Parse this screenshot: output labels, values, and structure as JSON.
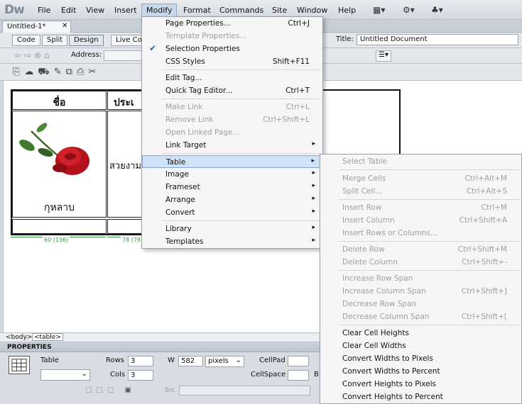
{
  "app": {
    "logo": "Dw"
  },
  "menubar": {
    "items": [
      "File",
      "Edit",
      "View",
      "Insert",
      "Modify",
      "Format",
      "Commands",
      "Site",
      "Window",
      "Help"
    ],
    "active": "Modify"
  },
  "document": {
    "tab_name": "Untitled-1*",
    "close": "✕",
    "views": [
      "Code",
      "Split",
      "Design",
      "Live Co"
    ],
    "title_label": "Title:",
    "title_value": "Untitled Document",
    "address_label": "Address:"
  },
  "canvas": {
    "table_headers": [
      "ชื่อ",
      "ประเ"
    ],
    "flower_name": "กุหลาบ",
    "description": "สวยงาม",
    "width_guides": [
      "60 (136)",
      "78 (79"
    ]
  },
  "tag_selector": [
    "<body>",
    "<table>"
  ],
  "properties": {
    "title": "PROPERTIES",
    "type_label": "Table",
    "rows_label": "Rows",
    "rows_value": "3",
    "cols_label": "Cols",
    "cols_value": "3",
    "w_label": "W",
    "w_value": "582",
    "w_unit": "pixels",
    "cellpad_label": "CellPad",
    "cellspace_label": "CellSpace",
    "border_label": "B",
    "src_label": "Src"
  },
  "modify_menu": [
    {
      "label": "Page Properties...",
      "shortcut": "Ctrl+J",
      "enabled": true
    },
    {
      "label": "Template Properties...",
      "shortcut": "",
      "enabled": false
    },
    {
      "label": "Selection Properties",
      "shortcut": "",
      "enabled": true,
      "checked": true
    },
    {
      "label": "CSS Styles",
      "shortcut": "Shift+F11",
      "enabled": true
    },
    {
      "label": "Edit Tag...",
      "shortcut": "",
      "enabled": true
    },
    {
      "label": "Quick Tag Editor...",
      "shortcut": "Ctrl+T",
      "enabled": true
    },
    {
      "label": "Make Link",
      "shortcut": "Ctrl+L",
      "enabled": false
    },
    {
      "label": "Remove Link",
      "shortcut": "Ctrl+Shift+L",
      "enabled": false
    },
    {
      "label": "Open Linked Page...",
      "shortcut": "",
      "enabled": false
    },
    {
      "label": "Link Target",
      "shortcut": "",
      "enabled": true,
      "submenu": true
    },
    {
      "label": "Table",
      "shortcut": "",
      "enabled": true,
      "submenu": true,
      "highlighted": true
    },
    {
      "label": "Image",
      "shortcut": "",
      "enabled": true,
      "submenu": true
    },
    {
      "label": "Frameset",
      "shortcut": "",
      "enabled": true,
      "submenu": true
    },
    {
      "label": "Arrange",
      "shortcut": "",
      "enabled": true,
      "submenu": true
    },
    {
      "label": "Convert",
      "shortcut": "",
      "enabled": true,
      "submenu": true
    },
    {
      "label": "Library",
      "shortcut": "",
      "enabled": true,
      "submenu": true
    },
    {
      "label": "Templates",
      "shortcut": "",
      "enabled": true,
      "submenu": true
    }
  ],
  "table_menu": [
    {
      "label": "Select Table",
      "shortcut": "",
      "enabled": false
    },
    {
      "label": "Merge Cells",
      "shortcut": "Ctrl+Alt+M",
      "enabled": false
    },
    {
      "label": "Split Cell...",
      "shortcut": "Ctrl+Alt+S",
      "enabled": false
    },
    {
      "label": "Insert Row",
      "shortcut": "Ctrl+M",
      "enabled": false
    },
    {
      "label": "Insert Column",
      "shortcut": "Ctrl+Shift+A",
      "enabled": false
    },
    {
      "label": "Insert Rows or Columns...",
      "shortcut": "",
      "enabled": false
    },
    {
      "label": "Delete Row",
      "shortcut": "Ctrl+Shift+M",
      "enabled": false
    },
    {
      "label": "Delete Column",
      "shortcut": "Ctrl+Shift+-",
      "enabled": false
    },
    {
      "label": "Increase Row Span",
      "shortcut": "",
      "enabled": false
    },
    {
      "label": "Increase Column Span",
      "shortcut": "Ctrl+Shift+]",
      "enabled": false
    },
    {
      "label": "Decrease Row Span",
      "shortcut": "",
      "enabled": false
    },
    {
      "label": "Decrease Column Span",
      "shortcut": "Ctrl+Shift+[",
      "enabled": false
    },
    {
      "label": "Clear Cell Heights",
      "shortcut": "",
      "enabled": true
    },
    {
      "label": "Clear Cell Widths",
      "shortcut": "",
      "enabled": true
    },
    {
      "label": "Convert Widths to Pixels",
      "shortcut": "",
      "enabled": true
    },
    {
      "label": "Convert Widths to Percent",
      "shortcut": "",
      "enabled": true
    },
    {
      "label": "Convert Heights to Pixels",
      "shortcut": "",
      "enabled": true
    },
    {
      "label": "Convert Heights to Percent",
      "shortcut": "",
      "enabled": true
    }
  ]
}
